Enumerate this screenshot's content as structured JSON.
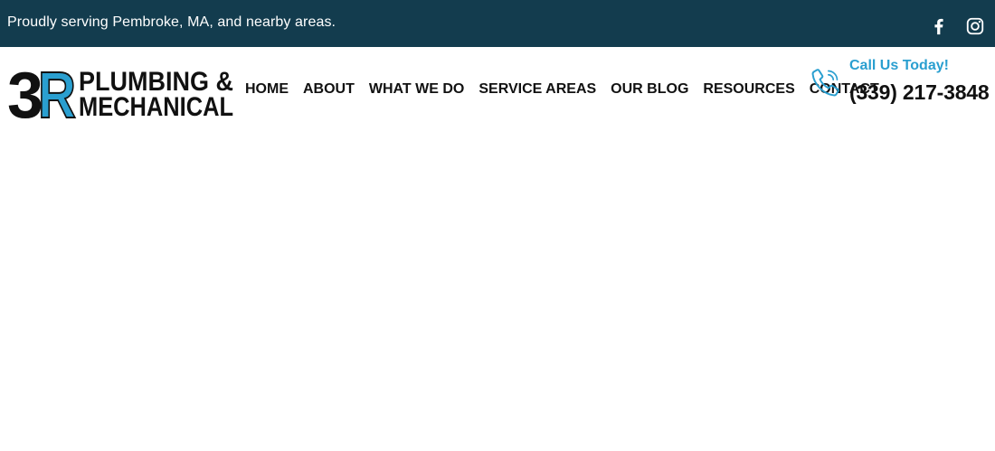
{
  "topbar": {
    "tagline": "Proudly serving Pembroke, MA, and nearby areas.",
    "social_icons": [
      "facebook-icon",
      "instagram-icon"
    ]
  },
  "logo": {
    "mark": "3R",
    "line1": "PLUMBING &",
    "line2": "MECHANICAL"
  },
  "nav": {
    "items": [
      {
        "label": "HOME"
      },
      {
        "label": "ABOUT"
      },
      {
        "label": "WHAT WE DO"
      },
      {
        "label": "SERVICE AREAS"
      },
      {
        "label": "OUR BLOG"
      },
      {
        "label": "RESOURCES"
      },
      {
        "label": "CONTACT"
      }
    ]
  },
  "contact": {
    "label": "Call Us Today!",
    "phone": "(339) 217-3848",
    "icon": "phone-icon"
  },
  "colors": {
    "topbar_bg": "#133c4e",
    "accent_blue": "#2a9fd0",
    "text_dark": "#111111"
  }
}
